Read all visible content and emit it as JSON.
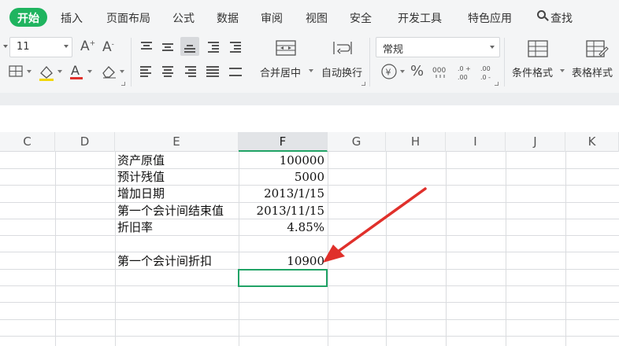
{
  "menu": {
    "tabs": [
      "开始",
      "插入",
      "页面布局",
      "公式",
      "数据",
      "审阅",
      "视图",
      "安全",
      "开发工具",
      "特色应用"
    ],
    "active_tab": "开始",
    "search_label": "查找"
  },
  "ribbon": {
    "font_size": "11",
    "grow_font_label": "A⁺",
    "shrink_font_label": "A⁻",
    "merge_center_label": "合并居中",
    "wrap_text_label": "自动换行",
    "number_format": "常规",
    "currency_symbol": "¥",
    "percent_symbol": "%",
    "thousands_symbol": "000",
    "increase_decimal_symbol": ".00→.0",
    "decrease_decimal_symbol": ".0→.00",
    "conditional_format_label": "条件格式",
    "table_style_label": "表格样式"
  },
  "columns": [
    "C",
    "D",
    "E",
    "F",
    "G",
    "H",
    "I",
    "J",
    "K"
  ],
  "active_column": "F",
  "sheet": {
    "rows": [
      {
        "label": "资产原值",
        "value": "100000"
      },
      {
        "label": "预计残值",
        "value": "5000"
      },
      {
        "label": "增加日期",
        "value": "2013/1/15"
      },
      {
        "label": "第一个会计间结束值",
        "value": "2013/11/15"
      },
      {
        "label": "折旧率",
        "value": "4.85%"
      },
      {
        "label": "",
        "value": ""
      },
      {
        "label": "第一个会计间折扣",
        "value": "10900"
      }
    ]
  },
  "colors": {
    "accent_green": "#1fb45f",
    "selection_border": "#21a366",
    "annotation_arrow": "#e0302b"
  }
}
